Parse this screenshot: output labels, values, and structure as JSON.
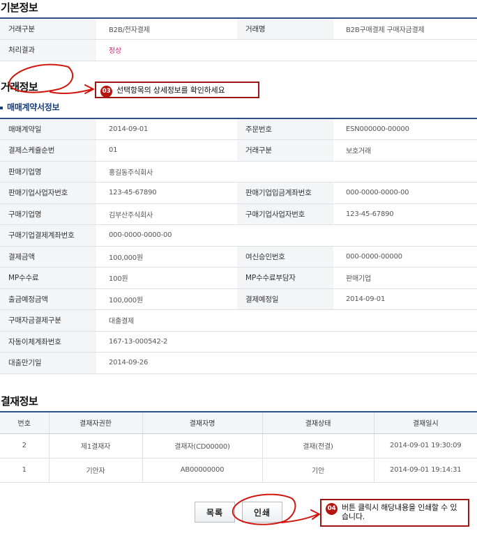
{
  "basic": {
    "title": "기본정보",
    "rows": [
      [
        "거래구분",
        "B2B/전자결제",
        "거래명",
        "B2B구매결제 구매자금결제"
      ],
      [
        "처리결과",
        "정상"
      ]
    ]
  },
  "transaction": {
    "title": "거래정보",
    "subtitle": "매매계약서정보",
    "rows": [
      [
        "매매계약일",
        "2014-09-01",
        "주문번호",
        "ESN000000-00000"
      ],
      [
        "결제스케쥴순번",
        "01",
        "거래구분",
        "보호거래"
      ],
      [
        "판매기업명",
        "홍길동주식회사"
      ],
      [
        "판매기업사업자번호",
        "123-45-67890",
        "판매기업입금계좌번호",
        "000-0000-0000-00"
      ],
      [
        "구매기업명",
        "김부산주식회사",
        "구매기업사업자번호",
        "123-45-67890"
      ],
      [
        "구매기업결제계좌번호",
        "000-0000-0000-00"
      ],
      [
        "결제금액",
        "100,000원",
        "여신승인번호",
        "000-0000-00000"
      ],
      [
        "MP수수료",
        "100원",
        "MP수수료부담자",
        "판매기업"
      ],
      [
        "출금예정금액",
        "100,000원",
        "결제예정일",
        "2014-09-01"
      ],
      [
        "구매자금결제구분",
        "대출결제"
      ],
      [
        "자동이체계좌번호",
        "167-13-000542-2"
      ],
      [
        "대출만기일",
        "2014-09-26"
      ]
    ]
  },
  "approval": {
    "title": "결재정보",
    "headers": [
      "번호",
      "결재자권한",
      "결재자명",
      "결재상태",
      "결재일시"
    ],
    "rows": [
      [
        "2",
        "제1결재자",
        "결재자(CD00000)",
        "결재(전결)",
        "2014-09-01 19:30:09"
      ],
      [
        "1",
        "기안자",
        "AB00000000",
        "기안",
        "2014-09-01 19:14:31"
      ]
    ]
  },
  "buttons": {
    "list": "목록",
    "print": "인쇄"
  },
  "callouts": [
    {
      "badge": "03",
      "text": "선택항목의 상세정보를 확인하세요"
    },
    {
      "badge": "04",
      "text": "버튼 클릭시 해당내용을 인쇄할 수 있습니다."
    }
  ],
  "colors": {
    "accent_line": "#2b4f88",
    "highlight": "#e0197d",
    "callout_red": "#b5140f"
  }
}
